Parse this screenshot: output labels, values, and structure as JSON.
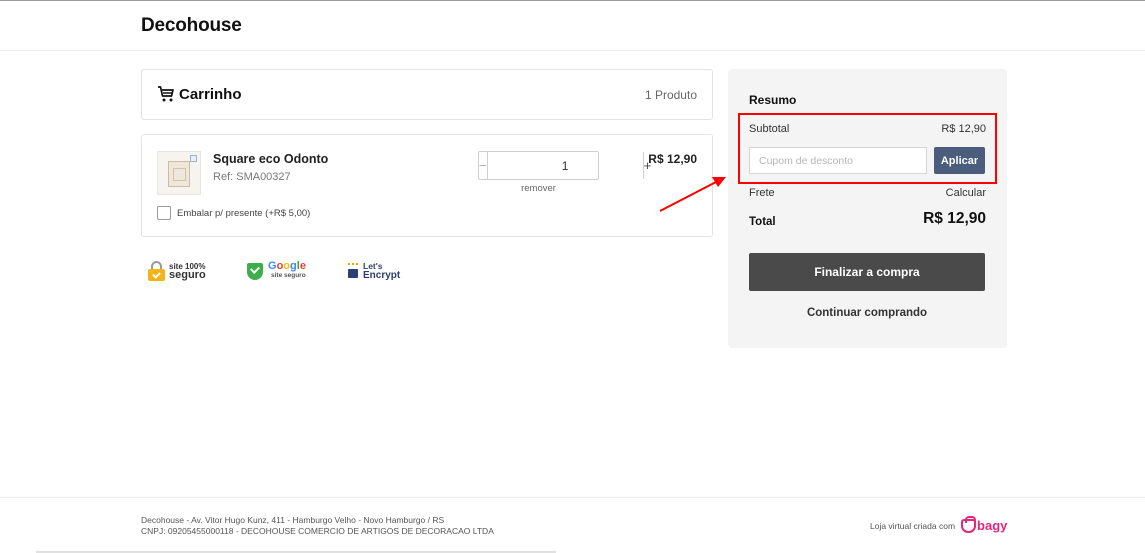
{
  "header": {
    "brand": "Decohouse"
  },
  "cart": {
    "title": "Carrinho",
    "count": "1 Produto",
    "item": {
      "name": "Square eco Odonto",
      "ref": "Ref: SMA00327",
      "quantity": "1",
      "qty_minus": "−",
      "qty_plus": "+",
      "remove": "remover",
      "price": "R$ 12,90",
      "gift_label": "Embalar p/ presente (+R$ 5,00)"
    }
  },
  "seals": {
    "site_seguro_top": "site 100%",
    "site_seguro_bottom": "seguro",
    "google_bottom": "site seguro",
    "google_letters": [
      "G",
      "o",
      "o",
      "g",
      "l",
      "e"
    ],
    "letsencrypt_top": "Let's",
    "letsencrypt_bottom": "Encrypt"
  },
  "summary": {
    "title": "Resumo",
    "subtotal_label": "Subtotal",
    "subtotal_value": "R$ 12,90",
    "coupon_placeholder": "Cupom de desconto",
    "apply_label": "Aplicar",
    "frete_label": "Frete",
    "frete_value": "Calcular",
    "total_label": "Total",
    "total_value": "R$ 12,90",
    "finalize_label": "Finalizar a compra",
    "continue_label": "Continuar comprando"
  },
  "footer": {
    "address": "Decohouse - Av. Vitor Hugo Kunz, 411 - Hamburgo Velho - Novo Hamburgo / RS",
    "cnpj": "CNPJ: 09205455000118 - DECOHOUSE COMERCIO DE ARTIGOS DE DECORACAO LTDA",
    "credit": "Loja virtual criada com",
    "platform": "bagy"
  },
  "colors": {
    "highlight": "#ff0000",
    "apply_button": "#4a5d7c",
    "finalize_button": "#4a4a4a",
    "summary_bg": "#f4f4f5",
    "bagy_pink": "#e6257f"
  }
}
